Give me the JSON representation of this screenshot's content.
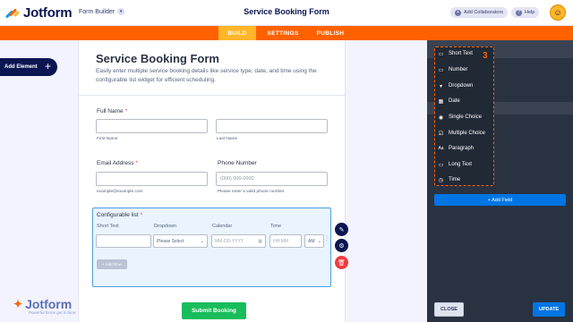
{
  "header": {
    "logo_text": "Jotform",
    "form_builder_label": "Form Builder",
    "form_title": "Service Booking Form",
    "add_collaborators": "Add Collaborators",
    "help": "Help"
  },
  "nav": {
    "tabs": [
      "BUILD",
      "SETTINGS",
      "PUBLISH"
    ],
    "active": "BUILD"
  },
  "sidebar": {
    "add_element": "Add Element"
  },
  "form": {
    "title": "Service Booking Form",
    "description": "Easily enter multiple service booking details like service type, date, and time using the configurable list widget for efficient scheduling.",
    "full_name": {
      "label": "Full Name",
      "required": "*",
      "first_sub": "First Name",
      "last_sub": "Last Name"
    },
    "email": {
      "label": "Email Address",
      "required": "*",
      "sub": "example@example.com"
    },
    "phone": {
      "label": "Phone Number",
      "placeholder": "(000) 000-0000",
      "sub": "Please enter a valid phone number."
    },
    "config_list": {
      "label": "Configurable list",
      "required": "*",
      "columns": [
        "Short Text",
        "Dropdown",
        "Calendar",
        "Time"
      ],
      "dropdown_value": "Please Select",
      "calendar_placeholder": "MM-DD-YYYY",
      "time_placeholder": "HH:MM",
      "ampm": "AM",
      "add_row": "+ Add Row"
    },
    "submit": "Submit Booking"
  },
  "watermark": {
    "name": "Jotform",
    "tagline": "Powerful forms get it done."
  },
  "right_panel": {
    "field_types": [
      {
        "label": "Short Text",
        "icon": "short-text-icon"
      },
      {
        "label": "Number",
        "icon": "number-icon"
      },
      {
        "label": "Dropdown",
        "icon": "dropdown-icon"
      },
      {
        "label": "Date",
        "icon": "date-icon"
      },
      {
        "label": "Single Choice",
        "icon": "radio-icon"
      },
      {
        "label": "Multiple Choice",
        "icon": "checkbox-icon"
      },
      {
        "label": "Paragraph",
        "icon": "paragraph-icon"
      },
      {
        "label": "Long Text",
        "icon": "long-text-icon"
      },
      {
        "label": "Time",
        "icon": "clock-icon"
      }
    ],
    "badge": "3",
    "add_field": "+ Add Field",
    "close": "CLOSE",
    "update": "UPDATE"
  },
  "colors": {
    "brand_orange": "#ff6100",
    "build_tab": "#ffb629",
    "navy": "#0a1551",
    "submit_green": "#18bd5b",
    "primary_blue": "#0075e3"
  }
}
